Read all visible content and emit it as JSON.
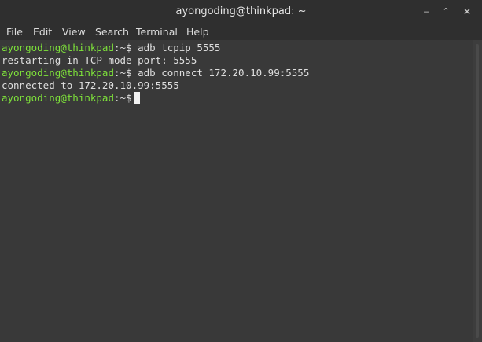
{
  "window": {
    "title": "ayongoding@thinkpad: ~",
    "buttons": {
      "minimize": "‒",
      "maximize": "⌃",
      "close": "✕"
    }
  },
  "menu": {
    "items": [
      "File",
      "Edit",
      "View",
      "Search",
      "Terminal",
      "Help"
    ]
  },
  "terminal": {
    "prompt_user": "ayongoding@thinkpad",
    "prompt_path": ":~$",
    "lines": [
      {
        "type": "command",
        "text": " adb tcpip 5555"
      },
      {
        "type": "output",
        "text": "restarting in TCP mode port: 5555"
      },
      {
        "type": "command",
        "text": " adb connect 172.20.10.99:5555"
      },
      {
        "type": "output",
        "text": "connected to 172.20.10.99:5555"
      },
      {
        "type": "prompt",
        "text": ""
      }
    ]
  },
  "colors": {
    "prompt_user": "#7ee23a",
    "text": "#dedede",
    "background": "#393939"
  }
}
